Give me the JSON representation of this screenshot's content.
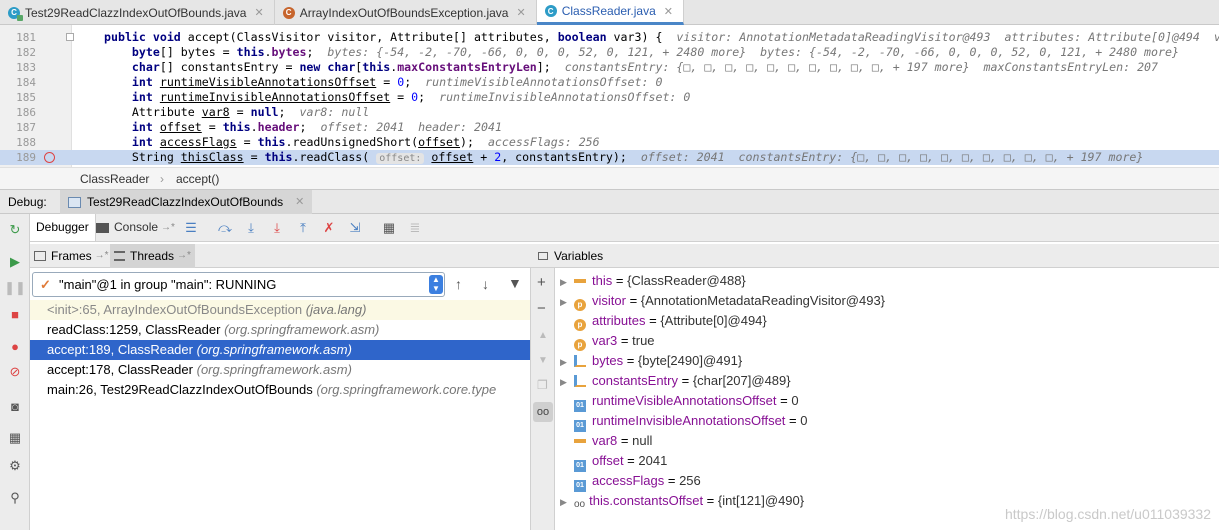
{
  "tabs": [
    {
      "label": "Test29ReadClazzIndexOutOfBounds.java",
      "active": false
    },
    {
      "label": "ArrayIndexOutOfBoundsException.java",
      "active": false
    },
    {
      "label": "ClassReader.java",
      "active": true
    }
  ],
  "editor": {
    "line_numbers": [
      "181",
      "182",
      "183",
      "184",
      "185",
      "186",
      "187",
      "188",
      "189"
    ],
    "current_line": "189"
  },
  "breadcrumb": {
    "class": "ClassReader",
    "method": "accept()"
  },
  "debug": {
    "label": "Debug:",
    "session": "Test29ReadClazzIndexOutOfBounds",
    "tabs": {
      "debugger": "Debugger",
      "console": "Console"
    },
    "frames_tab": "Frames",
    "threads_tab": "Threads",
    "variables_title": "Variables",
    "thread_selected": "\"main\"@1 in group \"main\": RUNNING"
  },
  "frames": [
    {
      "method": "<init>:65, ArrayIndexOutOfBoundsException",
      "package": "(java.lang)",
      "state": "lib"
    },
    {
      "method": "readClass:1259, ClassReader",
      "package": "(org.springframework.asm)",
      "state": ""
    },
    {
      "method": "accept:189, ClassReader",
      "package": "(org.springframework.asm)",
      "state": "sel"
    },
    {
      "method": "accept:178, ClassReader",
      "package": "(org.springframework.asm)",
      "state": ""
    },
    {
      "method": "main:26, Test29ReadClazzIndexOutOfBounds",
      "package": "(org.springframework.core.type",
      "state": ""
    }
  ],
  "variables": [
    {
      "name": "this",
      "value": "{ClassReader@488}",
      "icon": "field-icon",
      "expandable": true
    },
    {
      "name": "visitor",
      "value": "{AnnotationMetadataReadingVisitor@493}",
      "icon": "param-icon",
      "expandable": true
    },
    {
      "name": "attributes",
      "value": "{Attribute[0]@494}",
      "icon": "param-icon",
      "expandable": false
    },
    {
      "name": "var3",
      "value": "true",
      "icon": "param-icon",
      "expandable": false
    },
    {
      "name": "bytes",
      "value": "{byte[2490]@491}",
      "icon": "array-icon",
      "expandable": true
    },
    {
      "name": "constantsEntry",
      "value": "{char[207]@489}",
      "icon": "array-icon",
      "expandable": true
    },
    {
      "name": "runtimeVisibleAnnotationsOffset",
      "value": "0",
      "icon": "primitive-icon",
      "expandable": false
    },
    {
      "name": "runtimeInvisibleAnnotationsOffset",
      "value": "0",
      "icon": "primitive-icon",
      "expandable": false
    },
    {
      "name": "var8",
      "value": "null",
      "icon": "field-icon",
      "expandable": false
    },
    {
      "name": "offset",
      "value": "2041",
      "icon": "primitive-icon",
      "expandable": false
    },
    {
      "name": "accessFlags",
      "value": "256",
      "icon": "primitive-icon",
      "expandable": false
    },
    {
      "name": "this.constantsOffset",
      "value": "{int[121]@490}",
      "icon": "watch-icon",
      "expandable": true
    }
  ],
  "watermark": "https://blog.csdn.net/u011039332"
}
